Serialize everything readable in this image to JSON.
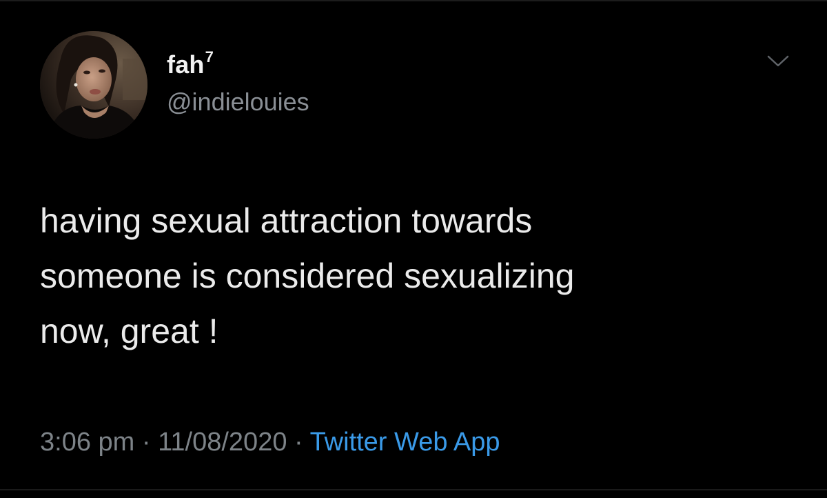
{
  "tweet": {
    "author": {
      "display_name": "fah",
      "name_suffix": "7",
      "handle": "@indielouies",
      "avatar_icon": "profile-photo"
    },
    "menu_icon": "chevron-down-icon",
    "text_lines": [
      "having sexual attraction towards",
      "someone is considered sexualizing",
      "now, great !"
    ],
    "time": "3:06 pm",
    "separator_1": " · ",
    "date": "11/08/2020",
    "separator_2": " · ",
    "source": "Twitter Web App"
  },
  "colors": {
    "background": "#000000",
    "text": "#ebebeb",
    "secondary_text": "#7d8388",
    "link": "#3a9ae8"
  }
}
